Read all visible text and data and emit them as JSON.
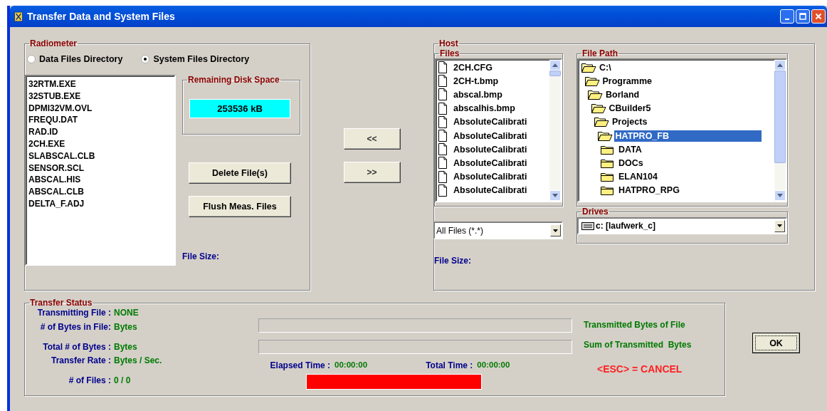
{
  "window": {
    "title": "Transfer Data and System Files"
  },
  "radiometer": {
    "title": "Radiometer",
    "directories": [
      {
        "label": "Data Files Directory",
        "selected": false
      },
      {
        "label": "System Files Directory",
        "selected": true
      }
    ],
    "files": [
      "32RTM.EXE",
      "32STUB.EXE",
      "DPMI32VM.OVL",
      "FREQU.DAT",
      "RAD.ID",
      "2CH.EXE",
      "SLABSCAL.CLB",
      "SENSOR.SCL",
      "ABSCAL.HIS",
      "ABSCAL.CLB",
      "DELTA_F.ADJ"
    ],
    "disk_space": {
      "title": "Remaining Disk Space",
      "value": "253536 kB"
    },
    "buttons": [
      "Delete File(s)",
      "Flush Meas. Files"
    ],
    "file_size_label": "File Size:"
  },
  "transfer_buttons": [
    "<<",
    ">>"
  ],
  "host": {
    "title": "Host",
    "files": {
      "title": "Files",
      "items": [
        "2CH.CFG",
        "2CH-t.bmp",
        "abscal.bmp",
        "abscalhis.bmp",
        "AbsoluteCalibrati",
        "AbsoluteCalibrati",
        "AbsoluteCalibrati",
        "AbsoluteCalibrati",
        "AbsoluteCalibrati",
        "AbsoluteCalibrati"
      ]
    },
    "file_path": {
      "title": "File Path",
      "items": [
        {
          "name": "C:\\",
          "expanded": true,
          "selected": false,
          "children": [
            {
              "name": "Programme",
              "expanded": true,
              "selected": false,
              "children": [
                {
                  "name": "Borland",
                  "expanded": true,
                  "selected": false,
                  "children": [
                    {
                      "name": "CBuilder5",
                      "expanded": true,
                      "selected": false,
                      "children": [
                        {
                          "name": "Projects",
                          "expanded": true,
                          "selected": false,
                          "children": [
                            {
                              "name": "HATPRO_FB",
                              "expanded": true,
                              "selected": true,
                              "children": [
                                {
                                  "name": "DATA",
                                  "expanded": false,
                                  "selected": false
                                },
                                {
                                  "name": "DOCs",
                                  "expanded": false,
                                  "selected": false
                                },
                                {
                                  "name": "ELAN104",
                                  "expanded": false,
                                  "selected": false
                                },
                                {
                                  "name": "HATPRO_RPG",
                                  "expanded": false,
                                  "selected": false
                                }
                              ]
                            }
                          ]
                        }
                      ]
                    }
                  ]
                }
              ]
            }
          ]
        }
      ]
    },
    "filter": {
      "value": "All Files (*.*)"
    },
    "drives": {
      "title": "Drives",
      "value": "c: [laufwerk_c]"
    },
    "file_size_label": "File Size:"
  },
  "transfer_status": {
    "title": "Transfer Status",
    "fields": [
      {
        "label": "Transmitting File :",
        "value": "NONE"
      },
      {
        "label": "# of Bytes in File:",
        "value": "Bytes"
      },
      {
        "label": "Total # of Bytes :",
        "value": "Bytes"
      },
      {
        "label": "Transfer Rate :",
        "value": "Bytes / Sec."
      },
      {
        "label": "# of Files :",
        "value": "0 / 0"
      }
    ],
    "progress": [
      {
        "level": 0,
        "caption": "Transmitted Bytes of File"
      },
      {
        "level": 0,
        "caption": "Sum of Transmitted  Bytes"
      }
    ],
    "elapsed": {
      "label": "Elapsed Time :",
      "value": "00:00:00"
    },
    "total_time": {
      "label": "Total Time :",
      "value": "00:00:00"
    },
    "cancel_hint": "<ESC> = CANCEL"
  },
  "ok_button": "OK"
}
